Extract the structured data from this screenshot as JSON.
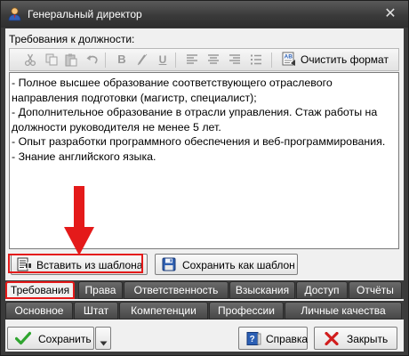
{
  "window": {
    "title": "Генеральный директор",
    "close_glyph": "✕"
  },
  "section": {
    "label": "Требования к должности:"
  },
  "toolbar": {
    "buttons": [
      "cut-icon",
      "copy-icon",
      "paste-icon",
      "undo-icon",
      "bold-icon",
      "italic-icon",
      "underline-icon",
      "align-left-icon",
      "align-center-icon",
      "align-right-icon",
      "bullet-list-icon"
    ],
    "clear_format_label": "Очистить формат"
  },
  "editor": {
    "lines": [
      "- Полное высшее образование соответствующего отраслевого направления подготовки (магистр, специалист);",
      "- Дополнительное образование в отрасли управления. Стаж работы на должности руководителя не менее 5 лет.",
      "- Опыт разработки программного обеспечения и веб-программирования.",
      "- Знание английского языка."
    ]
  },
  "template_buttons": {
    "insert_label": "Вставить из шаблона",
    "save_label": "Сохранить как шаблон"
  },
  "tabs": {
    "row1": [
      "Требования",
      "Права",
      "Ответственность",
      "Взыскания",
      "Доступ",
      "Отчёты"
    ],
    "row2": [
      "Основное",
      "Штат",
      "Компетенции",
      "Профессии",
      "Личные качества"
    ],
    "active": "Требования"
  },
  "footer": {
    "save_label": "Сохранить",
    "help_label": "Справка",
    "close_label": "Закрыть"
  },
  "colors": {
    "highlight_red": "#e41a1a",
    "save_check_green": "#2fa52f",
    "close_x_red": "#d11e1e",
    "help_blue": "#2b5fb4"
  }
}
